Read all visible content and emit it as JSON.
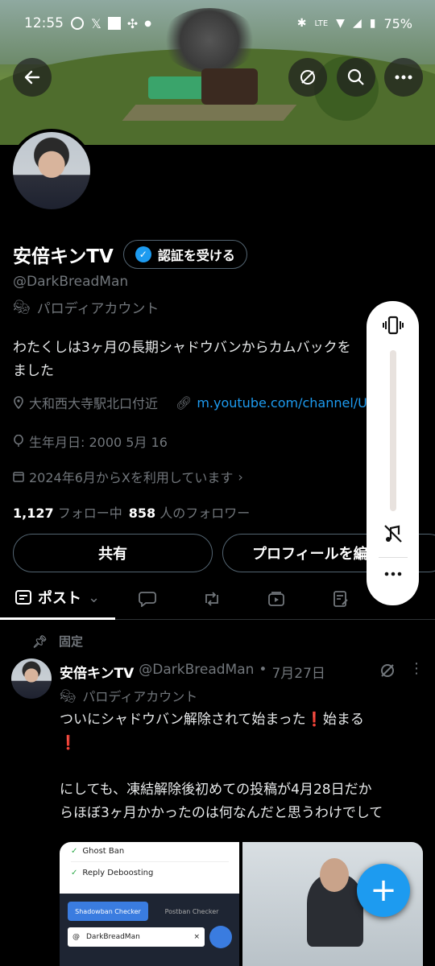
{
  "status_bar": {
    "time": "12:55",
    "left_icons": [
      "chat-bubble-icon",
      "x-logo-icon",
      "square-icon",
      "pinwheel-icon",
      "dot-icon"
    ],
    "battery": "75%"
  },
  "header": {
    "back_icon": "arrow-left-icon",
    "actions": [
      "mute-circle-icon",
      "search-icon",
      "more-icon"
    ]
  },
  "profile": {
    "display_name": "安倍キンTV",
    "verify_button": "認証を受ける",
    "handle": "@DarkBreadMan",
    "parody_label": "パロディアカウント",
    "bio_line1": "わたくしは3ヶ月の長期シャドウバンからカムバックを",
    "bio_line2": "ました",
    "location": "大和西大寺駅北口付近",
    "link": "m.youtube.com/channel/UC",
    "birthday": "生年月日: 2000 5月 16",
    "joined": "2024年6月からXを利用しています",
    "following_count": "1,127",
    "following_label": "フォロー中",
    "followers_count": "858",
    "followers_label": "人のフォロワー",
    "share_button": "共有",
    "edit_button": "プロフィールを編"
  },
  "tabs": {
    "posts_label": "ポスト",
    "icons": [
      "reply-icon",
      "repost-icon",
      "video-icon",
      "article-icon"
    ]
  },
  "pinned_post": {
    "pinned_label": "固定",
    "author_name": "安倍キンTV",
    "author_handle": "@DarkBreadMan",
    "separator": "•",
    "date": "7月27日",
    "parody_label": "パロディアカウント",
    "text": "ついにシャドウバン解除されて始まった❗始まる\n❗\n\nにしても、凍結解除後初めての投稿が4月28日だか\nらほぼ3ヶ月かかったのは何なんだと思うわけでして",
    "media": {
      "item1": "Ghost Ban",
      "item2": "Reply Deboosting",
      "tab_active": "Shadowban Checker",
      "tab_other": "Postban Checker",
      "at": "@",
      "input_value": "DarkBreadMan",
      "clear": "×"
    }
  },
  "fab": {
    "label": "+"
  },
  "colors": {
    "accent": "#1d9bf0",
    "background": "#000000",
    "muted": "#71767b"
  }
}
